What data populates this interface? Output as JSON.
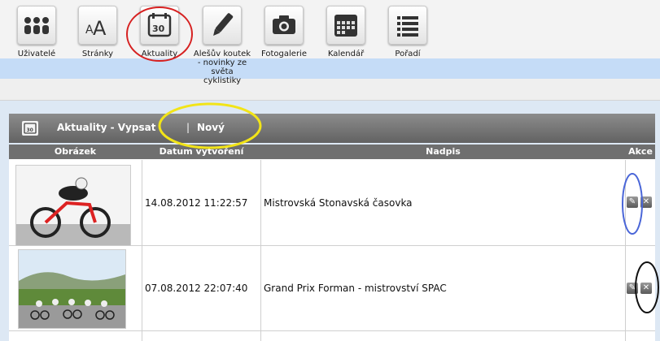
{
  "nav": {
    "items": [
      {
        "label": "Uživatelé"
      },
      {
        "label": "Stránky"
      },
      {
        "label": "Aktuality"
      },
      {
        "label": "Alešův koutek - novinky ze světa cyklistiky"
      },
      {
        "label": "Fotogalerie"
      },
      {
        "label": "Kalendář"
      },
      {
        "label": "Pořadí"
      }
    ]
  },
  "panel": {
    "title": "Aktuality - Vypsat",
    "separator": "|",
    "new_label": "Nový"
  },
  "table": {
    "columns": [
      "Obrázek",
      "Datum vytvoření",
      "Nadpis",
      "Akce"
    ],
    "rows": [
      {
        "date": "14.08.2012 11:22:57",
        "title": "Mistrovská Stonavská časovka"
      },
      {
        "date": "07.08.2012 22:07:40",
        "title": "Grand Prix Forman - mistrovství SPAC"
      }
    ]
  },
  "colors": {
    "accent_red": "#d62020",
    "accent_yellow": "#f2e418",
    "accent_blue": "#4a66d8"
  }
}
